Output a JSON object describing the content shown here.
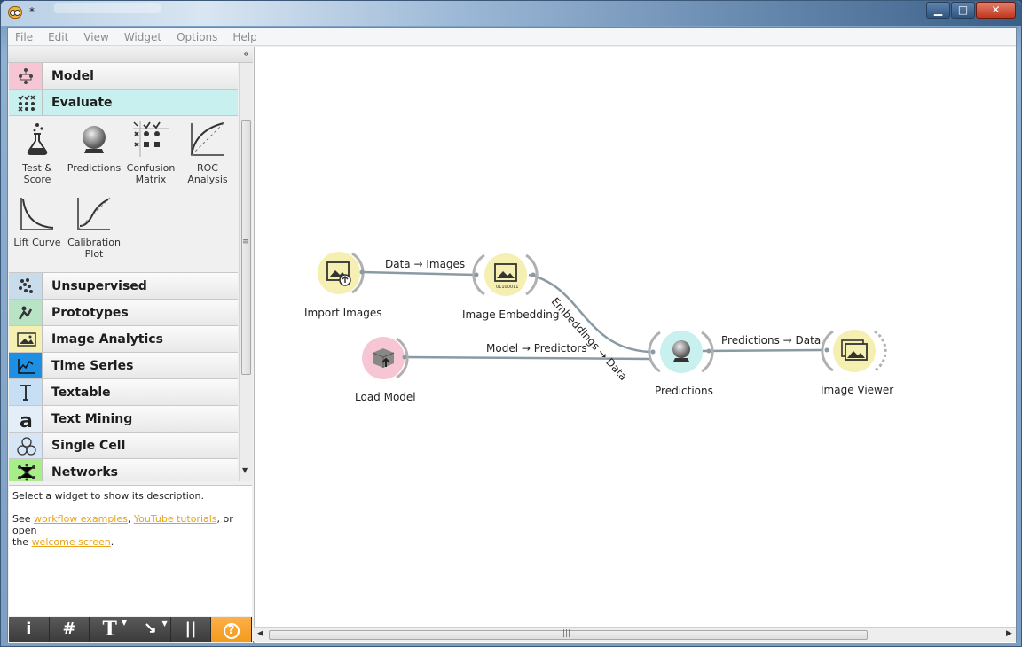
{
  "window": {
    "title": "*"
  },
  "menu": [
    "File",
    "Edit",
    "View",
    "Widget",
    "Options",
    "Help"
  ],
  "dock": {
    "collapse_label": "«",
    "categories_top": [
      {
        "label": "Model",
        "color": "#f7c6d4"
      },
      {
        "label": "Evaluate",
        "color": "#c7f0ee"
      }
    ],
    "evaluate_tools": [
      {
        "label": "Test &\nScore",
        "icon": "flask-icon"
      },
      {
        "label": "Predictions",
        "icon": "crystal-ball-icon"
      },
      {
        "label": "Confusion\nMatrix",
        "icon": "confusion-matrix-icon"
      },
      {
        "label": "ROC\nAnalysis",
        "icon": "roc-curve-icon"
      },
      {
        "label": "Lift Curve",
        "icon": "lift-curve-icon"
      },
      {
        "label": "Calibration\nPlot",
        "icon": "calibration-plot-icon"
      }
    ],
    "categories_bottom": [
      {
        "label": "Unsupervised",
        "color": "#c8dcec",
        "icon": "clusters-icon"
      },
      {
        "label": "Prototypes",
        "color": "#b9e3c5",
        "icon": "prototype-icon"
      },
      {
        "label": "Image Analytics",
        "color": "#f5efb2",
        "icon": "image-icon"
      },
      {
        "label": "Time Series",
        "color": "#1e8fe3",
        "icon": "time-series-icon"
      },
      {
        "label": "Textable",
        "color": "#c7dff5",
        "icon": "textable-icon"
      },
      {
        "label": "Text Mining",
        "color": "#e3eef9",
        "icon": "text-mining-icon"
      },
      {
        "label": "Single Cell",
        "color": "#d6e6f6",
        "icon": "single-cell-icon"
      },
      {
        "label": "Networks",
        "color": "#a8ee88",
        "icon": "network-icon"
      }
    ]
  },
  "description": {
    "line1": "Select a widget to show its description.",
    "see": "See ",
    "link1": "workflow examples",
    "sep1": ", ",
    "link2": "YouTube tutorials",
    "sep2": ", or open",
    "the": "the ",
    "link3": "welcome screen",
    "end": "."
  },
  "toolbar": [
    {
      "label": "i",
      "icon": "info-icon"
    },
    {
      "label": "#",
      "icon": "grid-icon"
    },
    {
      "label": "T",
      "icon": "text-annotation-icon"
    },
    {
      "label": "↘",
      "icon": "arrow-annotation-icon"
    },
    {
      "label": "||",
      "icon": "pause-icon"
    },
    {
      "label": "?",
      "icon": "help-icon"
    }
  ],
  "workflow": {
    "nodes": [
      {
        "id": "import-images",
        "label": "Import Images",
        "color": "#f5efb2"
      },
      {
        "id": "image-embedding",
        "label": "Image Embedding",
        "color": "#f5efb2"
      },
      {
        "id": "load-model",
        "label": "Load Model",
        "color": "#f7c6d4"
      },
      {
        "id": "predictions",
        "label": "Predictions",
        "color": "#c7f0ee"
      },
      {
        "id": "image-viewer",
        "label": "Image Viewer",
        "color": "#f5efb2"
      }
    ],
    "links": [
      {
        "label": "Data → Images"
      },
      {
        "label": "Embeddings → Data"
      },
      {
        "label": "Model → Predictors"
      },
      {
        "label": "Predictions → Data"
      }
    ]
  }
}
